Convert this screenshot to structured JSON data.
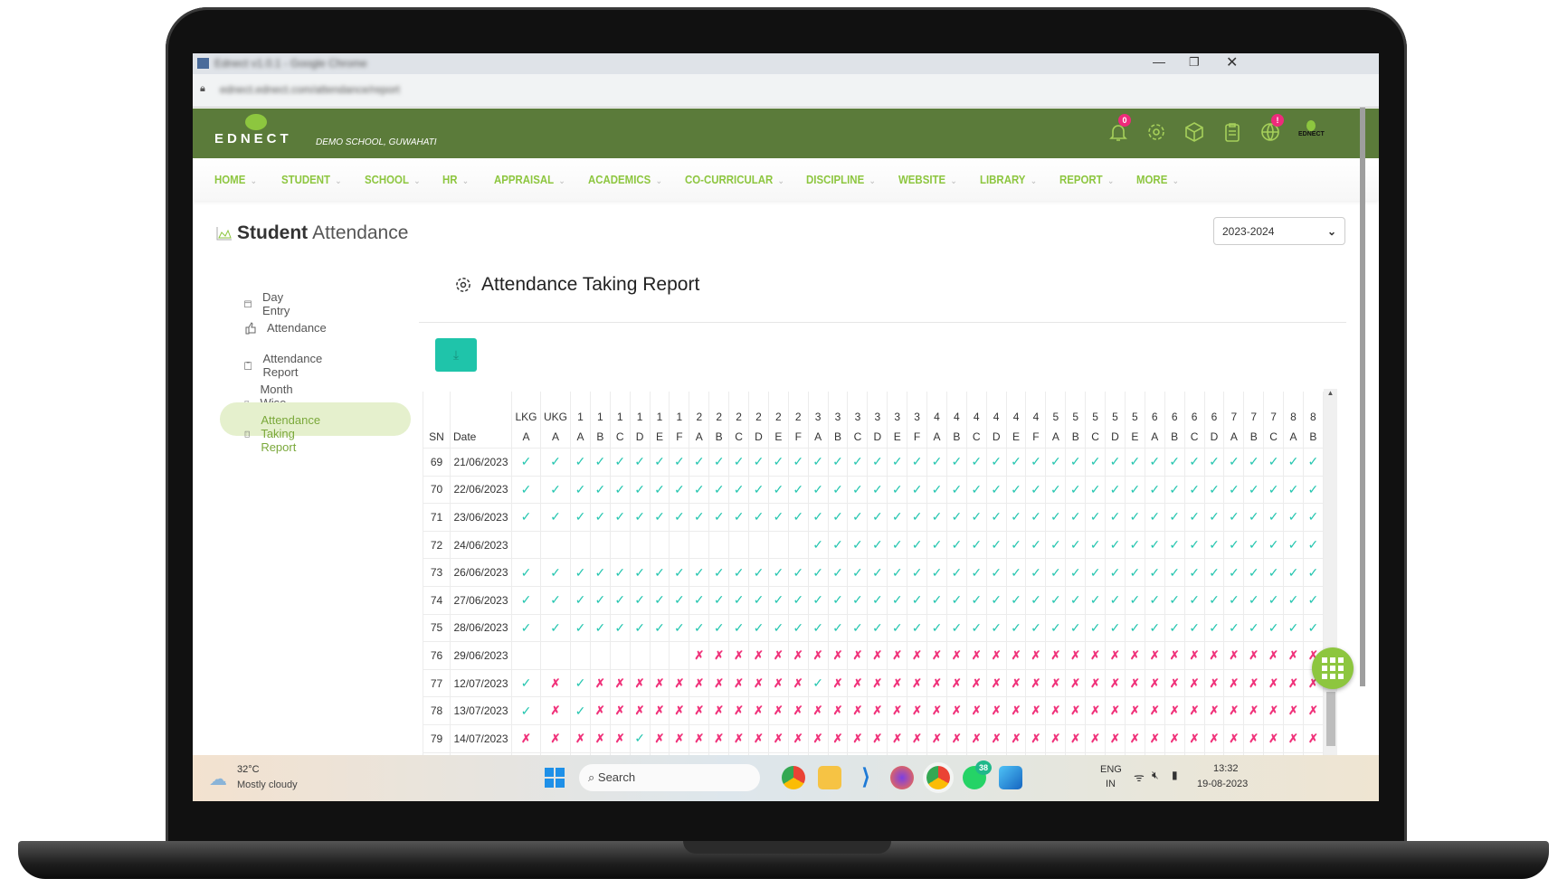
{
  "browser": {
    "title": "Ednect v1.0.1 - Google Chrome",
    "url": "ednect.ednect.com/attendance/report",
    "controls": [
      "minimize",
      "restore",
      "close"
    ]
  },
  "header": {
    "logo": "EDNECT",
    "school": "DEMO SCHOOL, GUWAHATI",
    "notifications_badge": "0",
    "globe_badge": "!",
    "avatar_label": "EDNECT",
    "brand_color": "#5b7b3a",
    "accent_color": "#8dc63f"
  },
  "nav": [
    "HOME",
    "STUDENT",
    "SCHOOL",
    "HR",
    "APPRAISAL",
    "ACADEMICS",
    "CO-CURRICULAR",
    "DISCIPLINE",
    "WEBSITE",
    "LIBRARY",
    "REPORT",
    "MORE"
  ],
  "page": {
    "title_bold": "Student",
    "title_rest": "Attendance",
    "year_select": "2023-2024",
    "heading": "Attendance Taking Report",
    "download_icon": "download-icon"
  },
  "sidebar": [
    {
      "label": "Day Entry",
      "icon": "calendar-icon"
    },
    {
      "label": "Attendance",
      "icon": "thumbs-up-icon"
    },
    {
      "label": "Attendance Report",
      "icon": "clipboard-icon"
    },
    {
      "label": "Month Wise Report",
      "icon": "building-icon"
    },
    {
      "label": "Attendance Taking Report",
      "icon": "building-icon",
      "active": true
    }
  ],
  "table": {
    "sn_header": "SN",
    "date_header": "Date",
    "class_headers": [
      "LKG",
      "UKG",
      "1",
      "1",
      "1",
      "1",
      "1",
      "1",
      "2",
      "2",
      "2",
      "2",
      "2",
      "2",
      "3",
      "3",
      "3",
      "3",
      "3",
      "3",
      "4",
      "4",
      "4",
      "4",
      "4",
      "4",
      "5",
      "5",
      "5",
      "5",
      "5",
      "6",
      "6",
      "6",
      "6",
      "7",
      "7",
      "7",
      "8",
      "8"
    ],
    "section_headers": [
      "A",
      "A",
      "A",
      "B",
      "C",
      "D",
      "E",
      "F",
      "A",
      "B",
      "C",
      "D",
      "E",
      "F",
      "A",
      "B",
      "C",
      "D",
      "E",
      "F",
      "A",
      "B",
      "C",
      "D",
      "E",
      "F",
      "A",
      "B",
      "C",
      "D",
      "E",
      "A",
      "B",
      "C",
      "D",
      "A",
      "B",
      "C",
      "A",
      "B"
    ],
    "legend": {
      "P": "✓",
      "A": "✗"
    },
    "rows": [
      {
        "sn": "69",
        "date": "21/06/2023",
        "marks": "PPPPPPPPPP PPPPPPPPPP PPPPPPPPPP PPPPPPPPPP"
      },
      {
        "sn": "70",
        "date": "22/06/2023",
        "marks": "PPPPPPPPPP PPPPPPPPPP PPPPPPPPPP PPPPPPPPPP"
      },
      {
        "sn": "71",
        "date": "23/06/2023",
        "marks": "PPPPPPPPPP PPPPPPPPPP PPPPPPPPPP PPPPPPPPPP"
      },
      {
        "sn": "72",
        "date": "24/06/2023",
        "marks": "---------- ----PPPPPP PPPPPPPPPP PPPPPPPPPP"
      },
      {
        "sn": "73",
        "date": "26/06/2023",
        "marks": "PPPPPPPPPP PPPPPPPPPP PPPPPPPPPP PPPPPPPPPP"
      },
      {
        "sn": "74",
        "date": "27/06/2023",
        "marks": "PPPPPPPPPP PPPPPPPPPP PPPPPPPPPP PPPPPPPPPP"
      },
      {
        "sn": "75",
        "date": "28/06/2023",
        "marks": "PPPPPPPPPP PPPPPPPPPP PPPPPPPPPP PPPPPPPPPP"
      },
      {
        "sn": "76",
        "date": "29/06/2023",
        "marks": "--------AA AAAAAAAAAA AAAAAAAAAA AAAAAAAAAA"
      },
      {
        "sn": "77",
        "date": "12/07/2023",
        "marks": "PAPAAAAAAA AAAAPAAAAA AAAAAAAAAA AAAAAAAAAA"
      },
      {
        "sn": "78",
        "date": "13/07/2023",
        "marks": "PAPAAAAAAA AAAAAAAAAA AAAAAAAAAA AAAAAAAAAA"
      },
      {
        "sn": "79",
        "date": "14/07/2023",
        "marks": "AAAAAPAAAA AAAAAAAAAA AAAAAAAAAA AAAAAAAAAA"
      }
    ],
    "present_color": "#26c6b0",
    "absent_color": "#f0327a"
  },
  "taskbar": {
    "weather_temp": "32°C",
    "weather_desc": "Mostly cloudy",
    "search": "Search",
    "whatsapp_badge": "38",
    "lang1": "ENG",
    "lang2": "IN",
    "time": "13:32",
    "date": "19-08-2023"
  }
}
